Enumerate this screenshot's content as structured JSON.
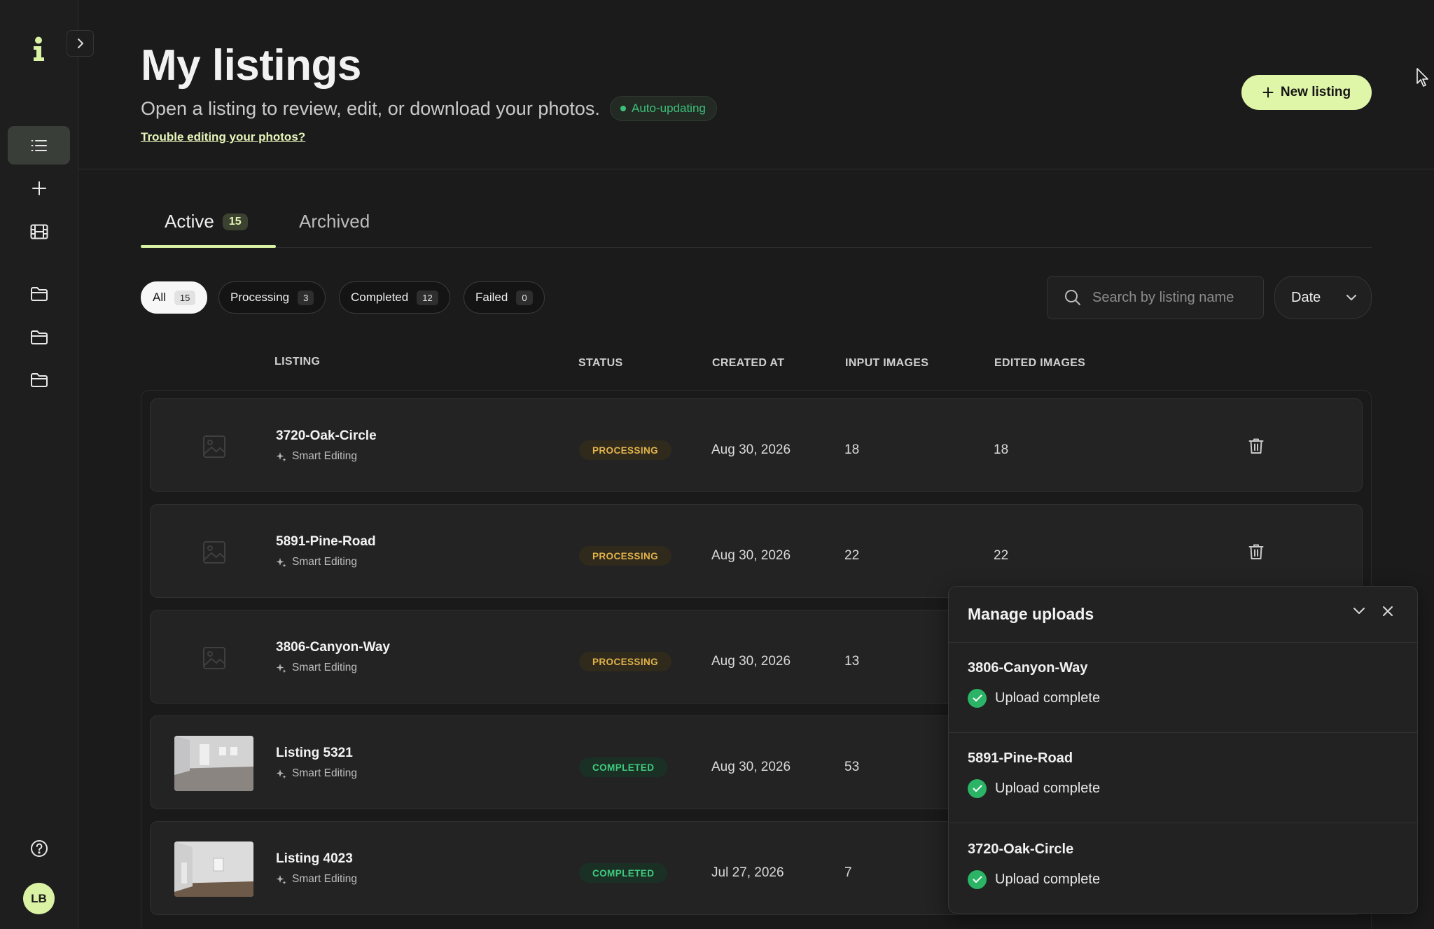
{
  "sidebar": {
    "expand_label": "Expand sidebar",
    "avatar_initials": "LB"
  },
  "header": {
    "title": "My listings",
    "subtitle": "Open a listing to review, edit, or download your photos.",
    "auto_badge": "Auto-updating",
    "help_link": "Trouble editing your photos?",
    "new_listing_label": "New listing"
  },
  "tabs": [
    {
      "label": "Active",
      "count": "15"
    },
    {
      "label": "Archived"
    }
  ],
  "filters": [
    {
      "label": "All",
      "count": "15"
    },
    {
      "label": "Processing",
      "count": "3"
    },
    {
      "label": "Completed",
      "count": "12"
    },
    {
      "label": "Failed",
      "count": "0"
    }
  ],
  "search": {
    "placeholder": "Search by listing name"
  },
  "sort": {
    "value": "Date"
  },
  "table": {
    "headers": [
      "LISTING",
      "STATUS",
      "CREATED AT",
      "INPUT IMAGES",
      "EDITED IMAGES"
    ],
    "rows": [
      {
        "name": "3720-Oak-Circle",
        "mode": "Smart Editing",
        "status": "PROCESSING",
        "created": "Aug 30, 2026",
        "input": "18",
        "edited": "18"
      },
      {
        "name": "5891-Pine-Road",
        "mode": "Smart Editing",
        "status": "PROCESSING",
        "created": "Aug 30, 2026",
        "input": "22",
        "edited": "22"
      },
      {
        "name": "3806-Canyon-Way",
        "mode": "Smart Editing",
        "status": "PROCESSING",
        "created": "Aug 30, 2026",
        "input": "13",
        "edited": ""
      },
      {
        "name": "Listing 5321",
        "mode": "Smart Editing",
        "status": "COMPLETED",
        "created": "Aug 30, 2026",
        "input": "53",
        "edited": ""
      },
      {
        "name": "Listing 4023",
        "mode": "Smart Editing",
        "status": "COMPLETED",
        "created": "Jul 27, 2026",
        "input": "7",
        "edited": ""
      }
    ]
  },
  "uploads": {
    "title": "Manage uploads",
    "items": [
      {
        "name": "3806-Canyon-Way",
        "status": "Upload complete"
      },
      {
        "name": "5891-Pine-Road",
        "status": "Upload complete"
      },
      {
        "name": "3720-Oak-Circle",
        "status": "Upload complete"
      }
    ]
  },
  "colors": {
    "accent": "#d9f2a3",
    "processing": "#e3b34c",
    "completed": "#3fca7e",
    "success": "#2cb466"
  }
}
